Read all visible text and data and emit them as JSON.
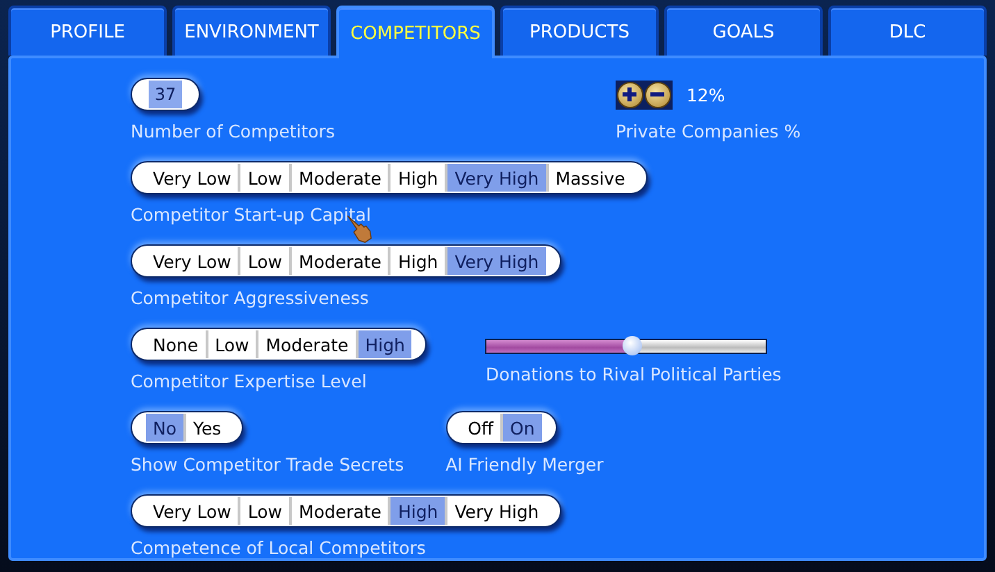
{
  "tabs": [
    {
      "label": "PROFILE",
      "selected": false
    },
    {
      "label": "ENVIRONMENT",
      "selected": false
    },
    {
      "label": "COMPETITORS",
      "selected": true
    },
    {
      "label": "PRODUCTS",
      "selected": false
    },
    {
      "label": "GOALS",
      "selected": false
    },
    {
      "label": "DLC",
      "selected": false
    }
  ],
  "rows": [
    {
      "items": [
        {
          "kind": "counter",
          "value": "37",
          "label": "Number of Competitors"
        },
        {
          "kind": "stepper",
          "value": "12%",
          "label": "Private Companies %"
        }
      ]
    },
    {
      "items": [
        {
          "kind": "segmented",
          "label": "Competitor Start-up Capital",
          "options": [
            {
              "label": "Very Low",
              "selected": false
            },
            {
              "label": "Low",
              "selected": false
            },
            {
              "label": "Moderate",
              "selected": false
            },
            {
              "label": "High",
              "selected": false
            },
            {
              "label": "Very High",
              "selected": true
            },
            {
              "label": "Massive",
              "selected": false
            }
          ]
        }
      ]
    },
    {
      "items": [
        {
          "kind": "segmented",
          "label": "Competitor Aggressiveness",
          "options": [
            {
              "label": "Very Low",
              "selected": false
            },
            {
              "label": "Low",
              "selected": false
            },
            {
              "label": "Moderate",
              "selected": false
            },
            {
              "label": "High",
              "selected": false
            },
            {
              "label": "Very High",
              "selected": true
            }
          ]
        }
      ]
    },
    {
      "items": [
        {
          "kind": "segmented",
          "label": "Competitor Expertise Level",
          "options": [
            {
              "label": "None",
              "selected": false
            },
            {
              "label": "Low",
              "selected": false
            },
            {
              "label": "Moderate",
              "selected": false
            },
            {
              "label": "High",
              "selected": true
            }
          ]
        },
        {
          "kind": "slider",
          "level": 0.52,
          "label": "Donations to Rival Political Parties"
        }
      ]
    },
    {
      "items": [
        {
          "kind": "segmented",
          "label": "Show Competitor Trade Secrets",
          "options": [
            {
              "label": "No",
              "selected": true
            },
            {
              "label": "Yes",
              "selected": false
            }
          ]
        },
        {
          "kind": "segmented",
          "label": "AI Friendly Merger",
          "options": [
            {
              "label": "Off",
              "selected": false
            },
            {
              "label": "On",
              "selected": true
            }
          ]
        }
      ]
    },
    {
      "items": [
        {
          "kind": "segmented",
          "label": "Competence of Local Competitors",
          "options": [
            {
              "label": "Very Low",
              "selected": false
            },
            {
              "label": "Low",
              "selected": false
            },
            {
              "label": "Moderate",
              "selected": false
            },
            {
              "label": "High",
              "selected": true
            },
            {
              "label": "Very High",
              "selected": false
            }
          ]
        }
      ]
    }
  ]
}
